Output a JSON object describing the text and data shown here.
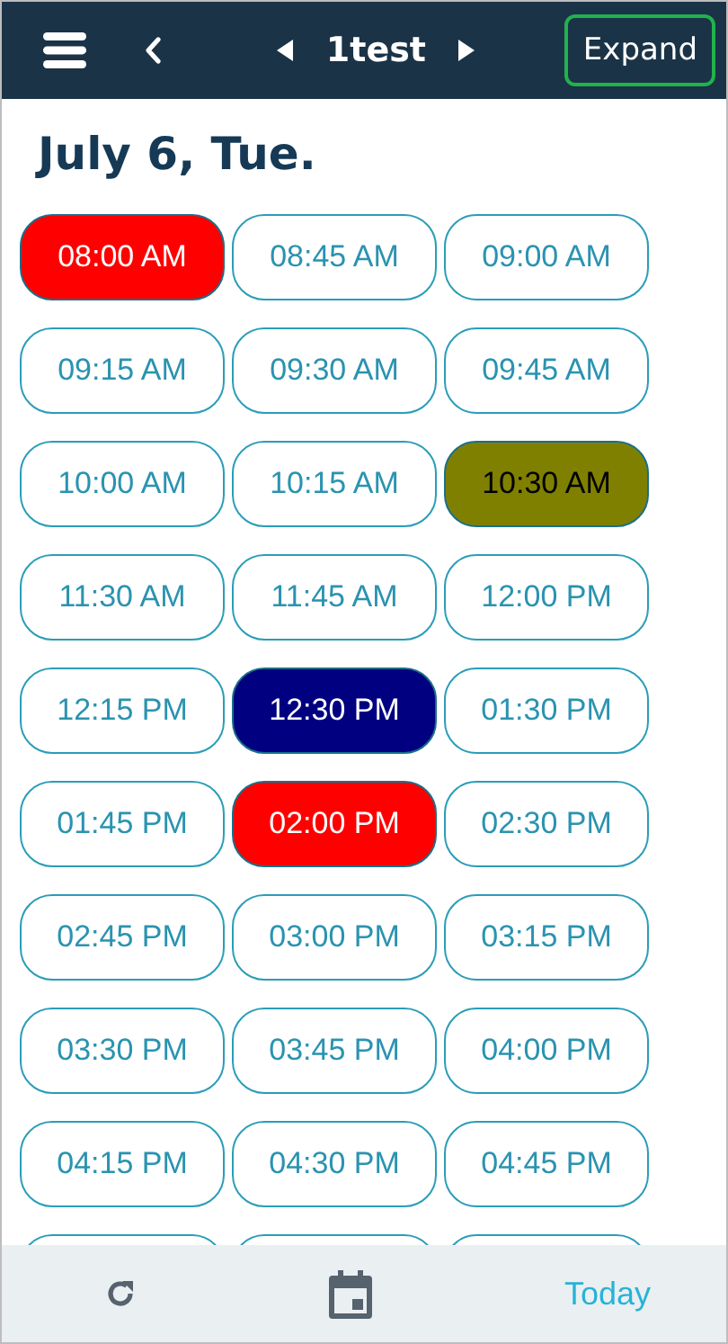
{
  "header": {
    "title": "1test",
    "expand_button": "Expand"
  },
  "date_heading": "July 6, Tue.",
  "slots": [
    {
      "kind": "slot",
      "time": "08:00 AM",
      "color": "#ff0000"
    },
    {
      "kind": "slot",
      "time": "08:45 AM"
    },
    {
      "kind": "slot",
      "time": "09:00 AM"
    },
    {
      "kind": "slot",
      "time": "09:15 AM"
    },
    {
      "kind": "slot",
      "time": "09:30 AM"
    },
    {
      "kind": "slot",
      "time": "09:45 AM"
    },
    {
      "kind": "slot",
      "time": "10:00 AM"
    },
    {
      "kind": "slot",
      "time": "10:15 AM"
    },
    {
      "kind": "slot",
      "time": "10:30 AM",
      "color": "#808000"
    },
    {
      "kind": "slot",
      "time": "11:30 AM"
    },
    {
      "kind": "slot",
      "time": "11:45 AM"
    },
    {
      "kind": "slot",
      "time": "12:00 PM"
    },
    {
      "kind": "slot",
      "time": "12:15 PM"
    },
    {
      "kind": "slot",
      "time": "12:30 PM",
      "color": "#000080"
    },
    {
      "kind": "slot",
      "time": "01:30 PM"
    },
    {
      "kind": "slot",
      "time": "01:45 PM"
    },
    {
      "kind": "slot",
      "time": "02:00 PM",
      "color": "#ff0000"
    },
    {
      "kind": "slot",
      "time": "02:30 PM"
    },
    {
      "kind": "slot",
      "time": "02:45 PM"
    },
    {
      "kind": "slot",
      "time": "03:00 PM"
    },
    {
      "kind": "slot",
      "time": "03:15 PM"
    },
    {
      "kind": "slot",
      "time": "03:30 PM"
    },
    {
      "kind": "slot",
      "time": "03:45 PM"
    },
    {
      "kind": "slot",
      "time": "04:00 PM"
    },
    {
      "kind": "slot",
      "time": "04:15 PM"
    },
    {
      "kind": "slot",
      "time": "04:30 PM"
    },
    {
      "kind": "slot",
      "time": "04:45 PM"
    },
    {
      "kind": "cut"
    },
    {
      "kind": "cut"
    },
    {
      "kind": "cut"
    }
  ],
  "bottom_bar": {
    "today_button": "Today"
  }
}
